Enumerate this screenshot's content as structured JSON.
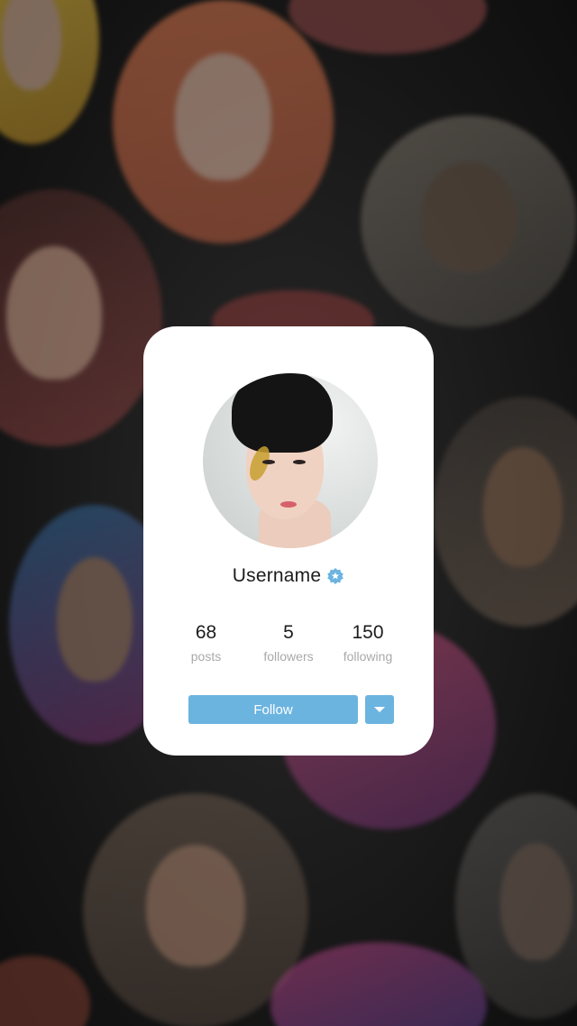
{
  "profile_card": {
    "username": "Username",
    "verified_icon": "verified-badge-icon",
    "stats": [
      {
        "value": "68",
        "label": "posts"
      },
      {
        "value": "5",
        "label": "followers"
      },
      {
        "value": "150",
        "label": "following"
      }
    ],
    "follow_label": "Follow",
    "menu_icon": "caret-down-icon"
  },
  "colors": {
    "accent": "#6cb4e0",
    "card_background": "#ffffff",
    "text_primary": "#1c1c1c",
    "text_secondary": "#a9a9a9"
  }
}
